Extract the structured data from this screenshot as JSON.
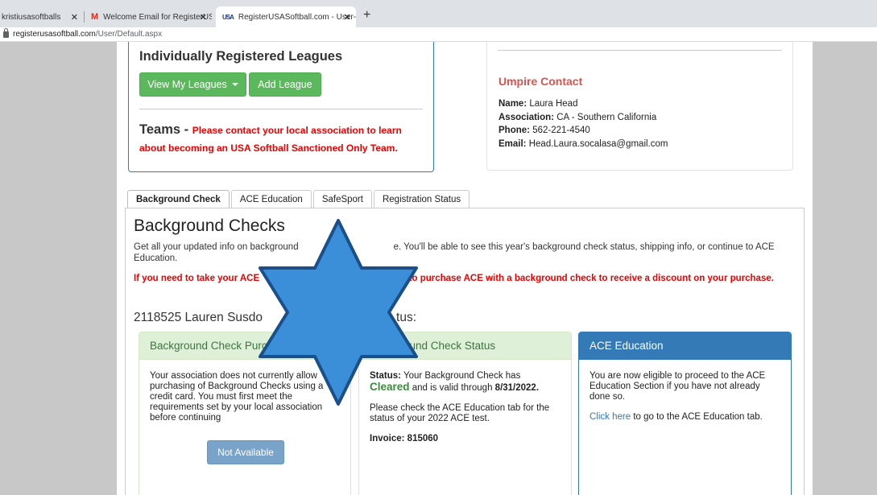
{
  "browser": {
    "tabs": [
      {
        "title": "kristiusasoftballs",
        "close": "✕"
      },
      {
        "title": "Welcome Email for RegisterUSAS",
        "close": "✕",
        "favicon": "M"
      },
      {
        "title": "RegisterUSASoftball.com - User-",
        "close": "✕",
        "favicon": "USA"
      }
    ],
    "new_tab": "+",
    "address": {
      "domain": "registerusasoftball.com",
      "path": "/User/Default.aspx"
    }
  },
  "leagues_panel": {
    "title": "Individually Registered Leagues",
    "view_button": "View My Leagues",
    "add_button": "Add League",
    "teams_label": "Teams - ",
    "teams_message": "Please contact your local association to learn about becoming an USA Softball Sanctioned Only Team."
  },
  "umpire_panel": {
    "title": "Umpire Contact",
    "name_label": "Name:",
    "name": "Laura Head",
    "association_label": "Association:",
    "association": "CA - Southern California",
    "phone_label": "Phone:",
    "phone": "562-221-4540",
    "email_label": "Email:",
    "email": "Head.Laura.socalasa@gmail.com"
  },
  "tabs": [
    {
      "label": "Background Check",
      "active": true
    },
    {
      "label": "ACE Education",
      "active": false
    },
    {
      "label": "SafeSport",
      "active": false
    },
    {
      "label": "Registration Status",
      "active": false
    }
  ],
  "background": {
    "title": "Background Checks",
    "desc_a": "Get all your updated info on background",
    "desc_b": "e. You'll be able to see this year's background check status, shipping info, or continue to ACE Education.",
    "warn_a": "If you need to take your ACE",
    "warn_b": "cation tab to purchase ACE with a background check to receive a discount on your purchase.",
    "user_a": "2118525 Lauren Susdo",
    "user_b": "tus:"
  },
  "cards": {
    "purchase": {
      "title": "Background Check Purchase",
      "body": "Your association does not currently allow purchasing of Background Checks using a credit card. You must first meet the requirements set by your local association before continuing",
      "button": "Not Available"
    },
    "status": {
      "title": "Background Check Status",
      "status_label": "Status:",
      "status_text": "Your Background Check has",
      "cleared": "Cleared",
      "valid_text": "and is valid through",
      "valid_date": "8/31/2022.",
      "check_text": "Please check the ACE Education tab for the status of your 2022 ACE test.",
      "invoice_label": "Invoice:",
      "invoice": "815060"
    },
    "ace": {
      "title": "ACE Education",
      "body": "You are now eligible to proceed to the ACE Education Section if you have not already done so.",
      "link": "Click here",
      "link_suffix": "to go to the ACE Education tab."
    }
  },
  "colors": {
    "star_fill": "#3a8fd8",
    "star_stroke": "#1a4f8a",
    "green": "#5cb85c",
    "primary": "#337ab7",
    "danger": "#e00000"
  }
}
